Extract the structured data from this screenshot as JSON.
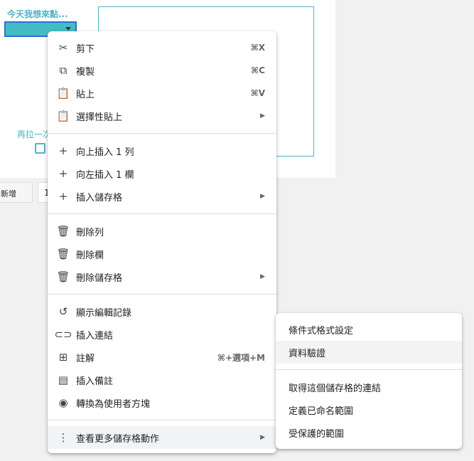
{
  "sheet": {
    "dropdown_label": "今天我想來點...",
    "second_label": "再拉一次",
    "add_button": "新增",
    "count_value": "1"
  },
  "context_menu": {
    "groups": [
      [
        {
          "icon": "scissors-icon",
          "glyph": "✂",
          "label": "剪下",
          "shortcut": "⌘X"
        },
        {
          "icon": "copy-icon",
          "glyph": "⧉",
          "label": "複製",
          "shortcut": "⌘C"
        },
        {
          "icon": "clipboard-icon",
          "glyph": "📋",
          "label": "貼上",
          "shortcut": "⌘V"
        },
        {
          "icon": "clipboard-icon",
          "glyph": "📋",
          "label": "選擇性貼上",
          "submenu": true
        }
      ],
      [
        {
          "icon": "plus-icon",
          "glyph": "+",
          "label": "向上插入 1 列"
        },
        {
          "icon": "plus-icon",
          "glyph": "+",
          "label": "向左插入 1 欄"
        },
        {
          "icon": "plus-icon",
          "glyph": "+",
          "label": "插入儲存格",
          "submenu": true
        }
      ],
      [
        {
          "icon": "trash-icon",
          "glyph": "🗑",
          "label": "刪除列"
        },
        {
          "icon": "trash-icon",
          "glyph": "🗑",
          "label": "刪除欄"
        },
        {
          "icon": "trash-icon",
          "glyph": "🗑",
          "label": "刪除儲存格",
          "submenu": true
        }
      ],
      [
        {
          "icon": "history-icon",
          "glyph": "↺",
          "label": "顯示編輯記錄"
        },
        {
          "icon": "link-icon",
          "glyph": "⊂⊃",
          "label": "插入連結"
        },
        {
          "icon": "comment-icon",
          "glyph": "⊞",
          "label": "註解",
          "shortcut": "⌘+選項+M"
        },
        {
          "icon": "note-icon",
          "glyph": "▤",
          "label": "插入備註"
        },
        {
          "icon": "person-chip-icon",
          "glyph": "◉",
          "label": "轉換為使用者方塊"
        }
      ],
      [
        {
          "icon": "more-vert-icon",
          "glyph": "⋮",
          "label": "查看更多儲存格動作",
          "submenu": true,
          "highlighted": true
        }
      ]
    ]
  },
  "submenu": {
    "groups": [
      [
        {
          "label": "條件式格式設定"
        },
        {
          "label": "資料驗證",
          "highlighted": true
        }
      ],
      [
        {
          "label": "取得這個儲存格的連結"
        },
        {
          "label": "定義已命名範圍"
        },
        {
          "label": "受保護的範圍"
        }
      ]
    ]
  }
}
